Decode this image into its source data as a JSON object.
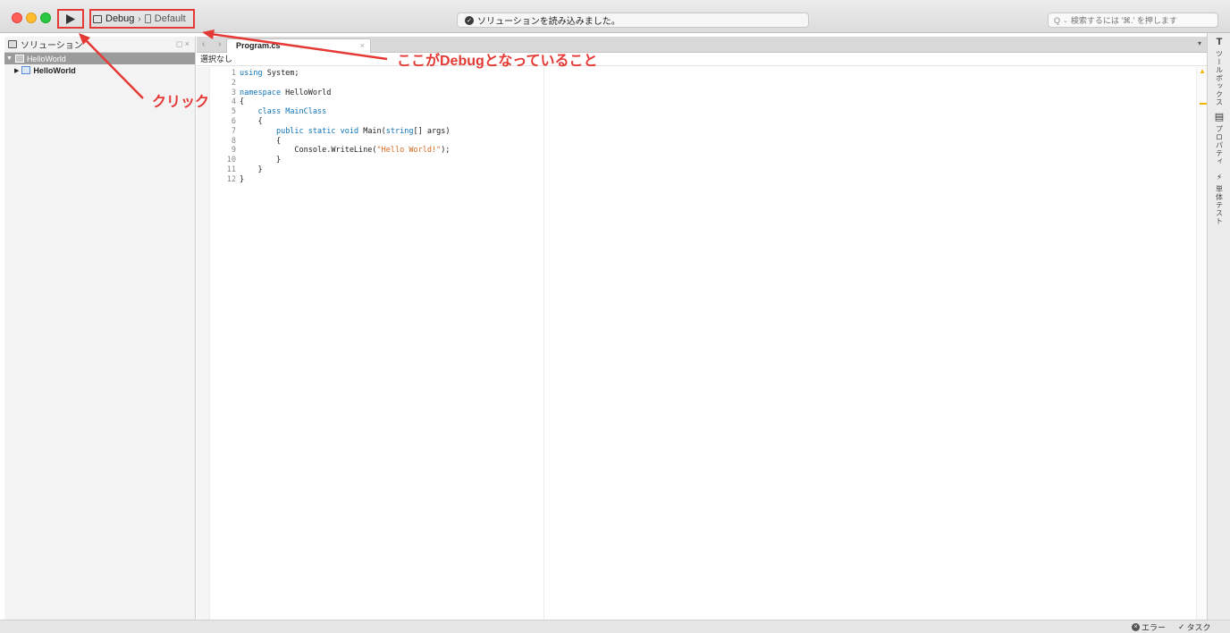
{
  "toolbar": {
    "configuration": "Debug",
    "separator": "›",
    "target": "Default",
    "status_message": "ソリューションを読み込みました。",
    "search_placeholder": "検索するには '⌘.' を押します"
  },
  "solution_pad": {
    "title": "ソリューション",
    "controls": "◻ ×",
    "items": [
      {
        "label": "HelloWorld",
        "level": 0,
        "selected": true
      },
      {
        "label": "HelloWorld",
        "level": 1,
        "selected": false
      }
    ]
  },
  "editor": {
    "nav_arrows": "‹ ›",
    "tab_label": "Program.cs",
    "tab_close": "×",
    "tab_dropdown": "▾",
    "path_selection": "選択なし",
    "code_lines": [
      {
        "n": "1",
        "tokens": [
          {
            "t": "using",
            "c": "kw"
          },
          {
            "t": " System;",
            "c": "plain"
          }
        ]
      },
      {
        "n": "2",
        "tokens": []
      },
      {
        "n": "3",
        "tokens": [
          {
            "t": "namespace",
            "c": "kw"
          },
          {
            "t": " HelloWorld",
            "c": "plain"
          }
        ]
      },
      {
        "n": "4",
        "tokens": [
          {
            "t": "{",
            "c": "plain"
          }
        ]
      },
      {
        "n": "5",
        "tokens": [
          {
            "t": "    ",
            "c": "plain"
          },
          {
            "t": "class",
            "c": "kw"
          },
          {
            "t": " MainClass",
            "c": "type"
          }
        ]
      },
      {
        "n": "6",
        "tokens": [
          {
            "t": "    {",
            "c": "plain"
          }
        ]
      },
      {
        "n": "7",
        "tokens": [
          {
            "t": "        ",
            "c": "plain"
          },
          {
            "t": "public static void",
            "c": "kw"
          },
          {
            "t": " Main(",
            "c": "plain"
          },
          {
            "t": "string",
            "c": "kw"
          },
          {
            "t": "[] args)",
            "c": "plain"
          }
        ]
      },
      {
        "n": "8",
        "tokens": [
          {
            "t": "        {",
            "c": "plain"
          }
        ]
      },
      {
        "n": "9",
        "tokens": [
          {
            "t": "            Console.WriteLine(",
            "c": "plain"
          },
          {
            "t": "\"Hello World!\"",
            "c": "str"
          },
          {
            "t": ");",
            "c": "plain"
          }
        ]
      },
      {
        "n": "10",
        "tokens": [
          {
            "t": "        }",
            "c": "plain"
          }
        ]
      },
      {
        "n": "11",
        "tokens": [
          {
            "t": "    }",
            "c": "plain"
          }
        ]
      },
      {
        "n": "12",
        "tokens": [
          {
            "t": "}",
            "c": "plain"
          }
        ]
      }
    ]
  },
  "right_dock": {
    "toolbox_glyph": "T",
    "toolbox_label": "ツールボックス",
    "properties_glyph": "▤",
    "properties_label": "プロパティ",
    "unittest_glyph": "⚡",
    "unittest_label": "単体テスト"
  },
  "status_bar": {
    "errors_label": "エラー",
    "tasks_label": "タスク"
  },
  "annotations": {
    "click_label": "クリック",
    "debug_label": "ここがDebugとなっていること",
    "color": "#e53935"
  }
}
